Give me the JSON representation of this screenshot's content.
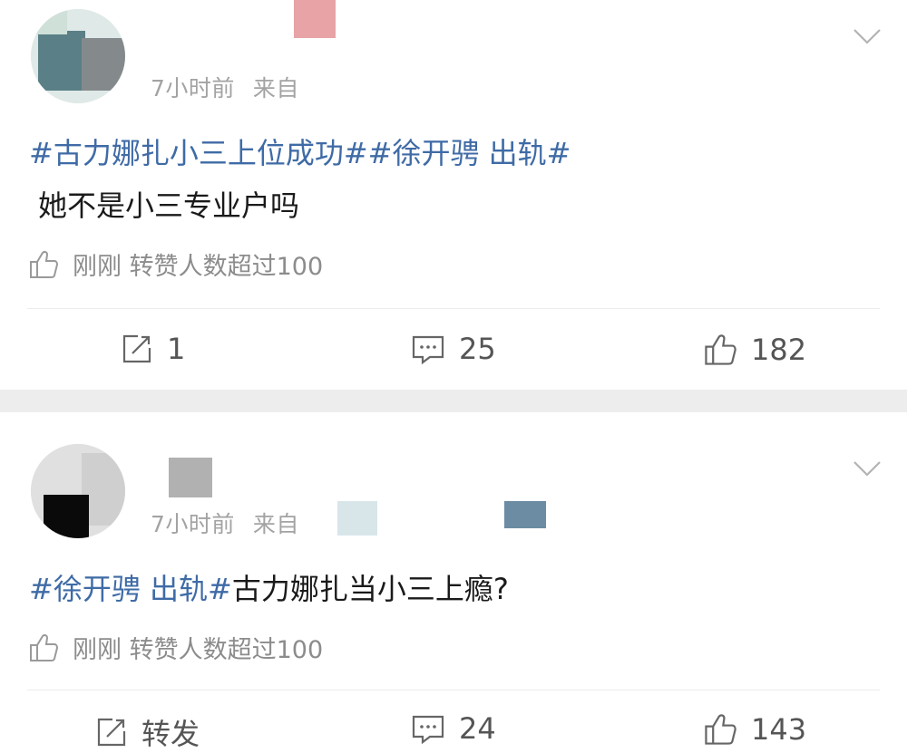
{
  "posts": [
    {
      "time": "7小时前",
      "source": "来自",
      "topics": "#古力娜扎小三上位成功##徐开骋 出轨#",
      "text": "她不是小三专业户吗",
      "like_note": "刚刚 转赞人数超过100",
      "actions": {
        "repost": "1",
        "comments": "25",
        "likes": "182"
      }
    },
    {
      "time": "7小时前",
      "source": "来自",
      "topics": "#徐开骋 出轨#",
      "text": "古力娜扎当小三上瘾?",
      "like_note": "刚刚 转赞人数超过100",
      "actions": {
        "repost": "转发",
        "comments": "24",
        "likes": "143"
      }
    }
  ],
  "icons": {
    "repost": "repost-icon",
    "comment": "comment-icon",
    "like": "thumbs-up-icon",
    "more": "chevron-down-icon"
  },
  "colors": {
    "topic": "#3f6ba6",
    "meta": "#a3a3a3",
    "separator": "#ededed"
  }
}
